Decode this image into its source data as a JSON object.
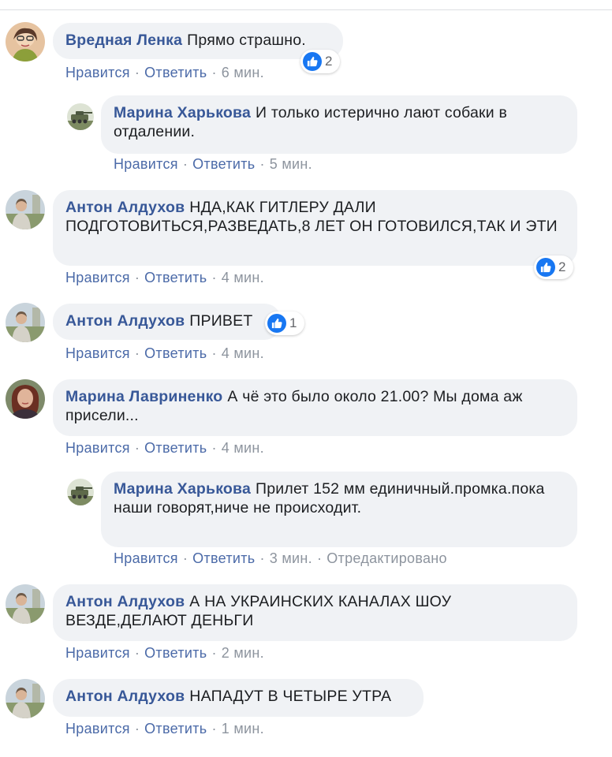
{
  "colors": {
    "author": "#385898",
    "action": "#4b6aa8",
    "meta": "#8d949e",
    "bubble": "#f0f2f5",
    "like": "#1877f2"
  },
  "comments": [
    {
      "author": "Вредная Ленка",
      "text": "Прямо страшно.",
      "like_label": "Нравится",
      "reply_label": "Ответить",
      "time": "6 мин.",
      "reactions": "2",
      "reaction_icon": "like-icon"
    },
    {
      "author": "Марина Харькова",
      "text": "И только истерично лают собаки в отдалении.",
      "like_label": "Нравится",
      "reply_label": "Ответить",
      "time": "5 мин."
    },
    {
      "author": "Антон Алдухов",
      "text": "НДА,КАК ГИТЛЕРУ ДАЛИ ПОДГОТОВИТЬСЯ,РАЗВЕДАТЬ,8 ЛЕТ ОН ГОТОВИЛСЯ,ТАК И ЭТИ",
      "like_label": "Нравится",
      "reply_label": "Ответить",
      "time": "4 мин.",
      "reactions": "2",
      "reaction_icon": "like-icon"
    },
    {
      "author": "Антон Алдухов",
      "text": "ПРИВЕТ",
      "like_label": "Нравится",
      "reply_label": "Ответить",
      "time": "4 мин.",
      "reactions": "1",
      "reaction_icon": "like-icon"
    },
    {
      "author": "Марина Лавриненко",
      "text": "А чё это было около 21.00? Мы дома аж присели...",
      "like_label": "Нравится",
      "reply_label": "Ответить",
      "time": "4 мин."
    },
    {
      "author": "Марина Харькова",
      "text": "Прилет 152 мм единичный.промка.пока наши говорят,ниче не происходит.",
      "like_label": "Нравится",
      "reply_label": "Ответить",
      "time": "3 мин.",
      "edited": "Отредактировано"
    },
    {
      "author": "Антон Алдухов",
      "text": "А НА УКРАИНСКИХ КАНАЛАХ ШОУ ВЕЗДЕ,ДЕЛАЮТ ДЕНЬГИ",
      "like_label": "Нравится",
      "reply_label": "Ответить",
      "time": "2 мин."
    },
    {
      "author": "Антон Алдухов",
      "text": "НАПАДУТ В ЧЕТЫРЕ УТРА",
      "like_label": "Нравится",
      "reply_label": "Ответить",
      "time": "1 мин."
    }
  ]
}
